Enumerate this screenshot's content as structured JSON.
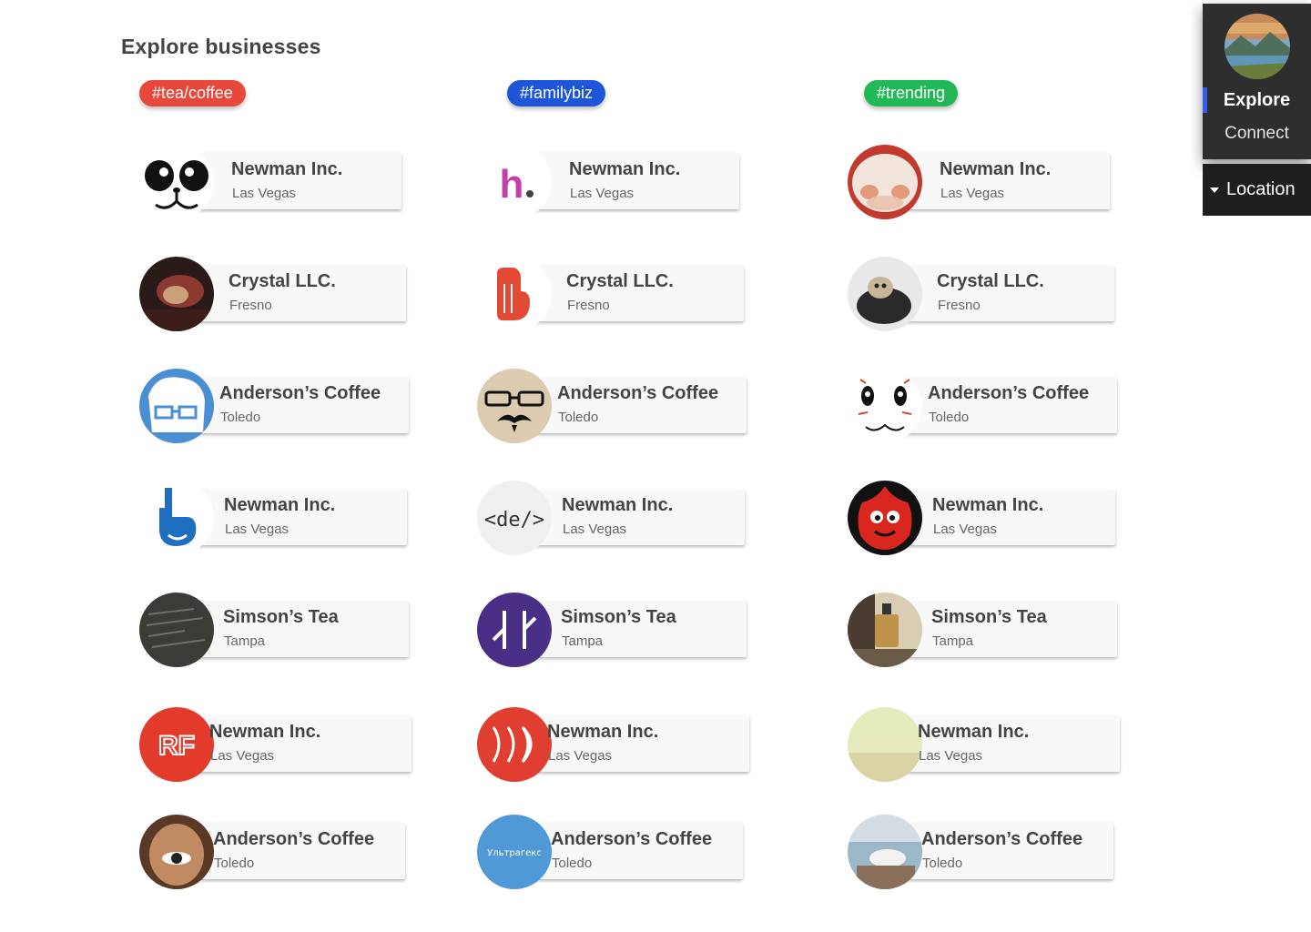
{
  "page": {
    "title": "Explore businesses"
  },
  "columns": [
    {
      "tag": {
        "label": "#tea/coffee",
        "color": "#e8473c"
      },
      "cards": [
        {
          "name": "Newman Inc.",
          "city": "Las Vegas",
          "icon": "panda-face-icon"
        },
        {
          "name": "Crystal LLC.",
          "city": "Fresno",
          "icon": "dark-photo-avatar"
        },
        {
          "name": "Anderson’s Coffee",
          "city": "Toledo",
          "icon": "glasses-face-icon"
        },
        {
          "name": "Newman Inc.",
          "city": "Las Vegas",
          "icon": "pointing-hand-icon"
        },
        {
          "name": "Simson’s Tea",
          "city": "Tampa",
          "icon": "code-screen-avatar"
        },
        {
          "name": "Newman Inc.",
          "city": "Las Vegas",
          "icon": "rf-logo-icon"
        },
        {
          "name": "Anderson’s Coffee",
          "city": "Toledo",
          "icon": "eye-hand-avatar"
        }
      ]
    },
    {
      "tag": {
        "label": "#familybiz",
        "color": "#1e56d9"
      },
      "cards": [
        {
          "name": "Newman Inc.",
          "city": "Las Vegas",
          "icon": "h-logo-icon"
        },
        {
          "name": "Crystal LLC.",
          "city": "Fresno",
          "icon": "hand-logo-icon"
        },
        {
          "name": "Anderson’s Coffee",
          "city": "Toledo",
          "icon": "mustache-face-icon"
        },
        {
          "name": "Newman Inc.",
          "city": "Las Vegas",
          "icon": "code-tag-icon"
        },
        {
          "name": "Simson’s Tea",
          "city": "Tampa",
          "icon": "purple-logo-icon"
        },
        {
          "name": "Newman Inc.",
          "city": "Las Vegas",
          "icon": "red-swirl-logo-icon"
        },
        {
          "name": "Anderson’s Coffee",
          "city": "Toledo",
          "icon": "blue-text-logo",
          "logo_text": "Ультрагекс"
        }
      ]
    },
    {
      "tag": {
        "label": "#trending",
        "color": "#22b857"
      },
      "cards": [
        {
          "name": "Newman Inc.",
          "city": "Las Vegas",
          "icon": "cow-face-avatar"
        },
        {
          "name": "Crystal LLC.",
          "city": "Fresno",
          "icon": "sloth-avatar"
        },
        {
          "name": "Anderson’s Coffee",
          "city": "Toledo",
          "icon": "cat-face-icon"
        },
        {
          "name": "Newman Inc.",
          "city": "Las Vegas",
          "icon": "red-monster-icon"
        },
        {
          "name": "Simson’s Tea",
          "city": "Tampa",
          "icon": "tea-press-avatar"
        },
        {
          "name": "Newman Inc.",
          "city": "Las Vegas",
          "icon": "pale-green-avatar"
        },
        {
          "name": "Anderson’s Coffee",
          "city": "Toledo",
          "icon": "cup-photo-avatar"
        }
      ]
    }
  ],
  "side_nav": {
    "avatar_icon": "landscape-avatar",
    "explore": "Explore",
    "connect": "Connect",
    "location": "Location",
    "active_color": "#2f5be8"
  }
}
